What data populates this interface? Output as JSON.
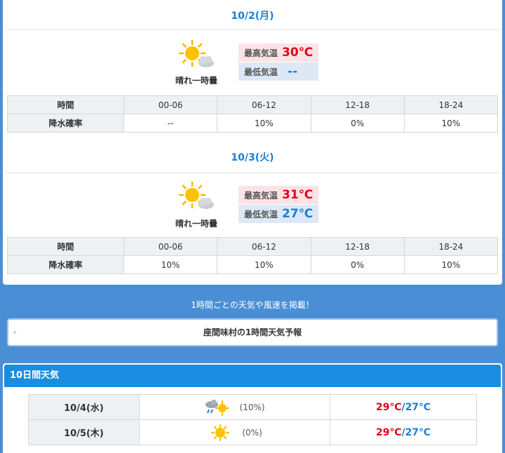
{
  "today": {
    "date": "10/2(月)",
    "icon": "sunny-then-cloudy-icon",
    "weather": "晴れ一時曇",
    "high_label": "最高気温",
    "high": "30℃",
    "low_label": "最低気温",
    "low": "--",
    "rain": {
      "row_header": "時間",
      "row_label": "降水確率",
      "periods": [
        "00-06",
        "06-12",
        "12-18",
        "18-24"
      ],
      "values": [
        "--",
        "10%",
        "0%",
        "10%"
      ]
    }
  },
  "tomorrow": {
    "date": "10/3(火)",
    "icon": "sunny-then-cloudy-icon",
    "weather": "晴れ一時曇",
    "high_label": "最高気温",
    "high": "31℃",
    "low_label": "最低気温",
    "low": "27℃",
    "rain": {
      "row_header": "時間",
      "row_label": "降水確率",
      "periods": [
        "00-06",
        "06-12",
        "12-18",
        "18-24"
      ],
      "values": [
        "10%",
        "10%",
        "0%",
        "10%"
      ]
    }
  },
  "promo": {
    "text": "1時間ごとの天気や風速を掲載！",
    "button_label": "座間味村の1時間天気予報"
  },
  "ten_day": {
    "title": "10日間天気",
    "rows": [
      {
        "date": "10/4(水)",
        "icon": "cloudy-rain-sun-icon",
        "rain": "(10%)",
        "high": "29℃",
        "low": "27℃",
        "sep": "/"
      },
      {
        "date": "10/5(木)",
        "icon": "sunny-icon",
        "rain": "(0%)",
        "high": "29℃",
        "low": "27℃",
        "sep": "/"
      }
    ]
  },
  "colors": {
    "accent": "#1a7fd4",
    "high": "#e0001b",
    "background": "#4a8fd6"
  }
}
